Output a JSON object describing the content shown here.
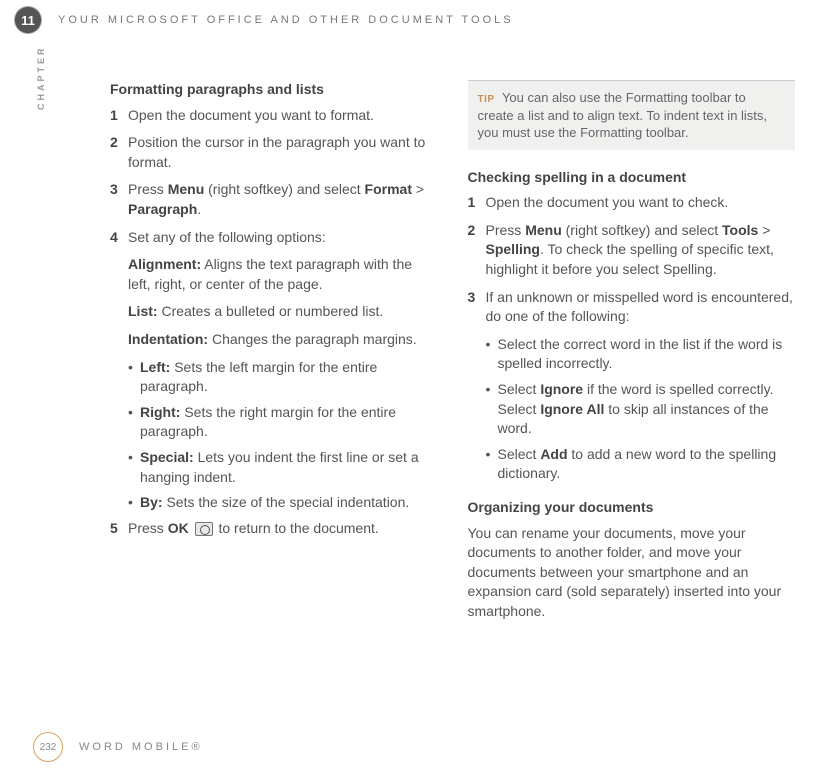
{
  "chapterNumber": "11",
  "headerTitle": "YOUR MICROSOFT OFFICE AND OTHER DOCUMENT TOOLS",
  "chapterLabel": "CHAPTER",
  "left": {
    "heading": "Formatting paragraphs and lists",
    "s1": "Open the document you want to format.",
    "s2": "Position the cursor in the paragraph you want to format.",
    "s3a": "Press ",
    "s3b": "Menu",
    "s3c": " (right softkey) and select ",
    "s3d": "Format",
    "s3e": " > ",
    "s3f": "Paragraph",
    "s3g": ".",
    "s4": "Set any of the following options:",
    "alignLabel": "Alignment:",
    "alignBody": " Aligns the text paragraph with the left, right, or center of the page.",
    "listLabel": "List:",
    "listBody": " Creates a bulleted or numbered list.",
    "indentLabel": "Indentation:",
    "indentBody": " Changes the paragraph margins.",
    "bLeftLabel": "Left:",
    "bLeftBody": " Sets the left margin for the entire paragraph.",
    "bRightLabel": "Right:",
    "bRightBody": " Sets the right margin for the entire paragraph.",
    "bSpecialLabel": "Special:",
    "bSpecialBody": " Lets you indent the first line or set a hanging indent.",
    "bByLabel": "By:",
    "bByBody": " Sets the size of the special indentation.",
    "s5a": "Press ",
    "s5b": "OK",
    "s5c": " to return to the document."
  },
  "right": {
    "tipLabel": "TIP",
    "tipBody": " You can also use the Formatting toolbar to create a list and to align text. To indent text in lists, you must use the Formatting toolbar.",
    "heading1": "Checking spelling in a document",
    "c1": "Open the document you want to check.",
    "c2a": "Press ",
    "c2b": "Menu",
    "c2c": " (right softkey) and select ",
    "c2d": "Tools",
    "c2e": " > ",
    "c2f": "Spelling",
    "c2g": ". To check the spelling of specific text, highlight it before you select Spelling.",
    "c3": "If an unknown or misspelled word is encountered, do one of the following:",
    "cb1": "Select the correct word in the list if the word is spelled incorrectly.",
    "cb2a": "Select ",
    "cb2b": "Ignore",
    "cb2c": " if the word is spelled correctly. Select ",
    "cb2d": "Ignore All",
    "cb2e": " to skip all instances of the word.",
    "cb3a": "Select ",
    "cb3b": "Add",
    "cb3c": " to add a new word to the spelling dictionary.",
    "heading2": "Organizing your documents",
    "orgBody": "You can rename your documents, move your documents to another folder, and move your documents between your smartphone and an expansion card (sold separately) inserted into your smartphone."
  },
  "pageNumber": "232",
  "footerTitle": "WORD MOBILE®"
}
